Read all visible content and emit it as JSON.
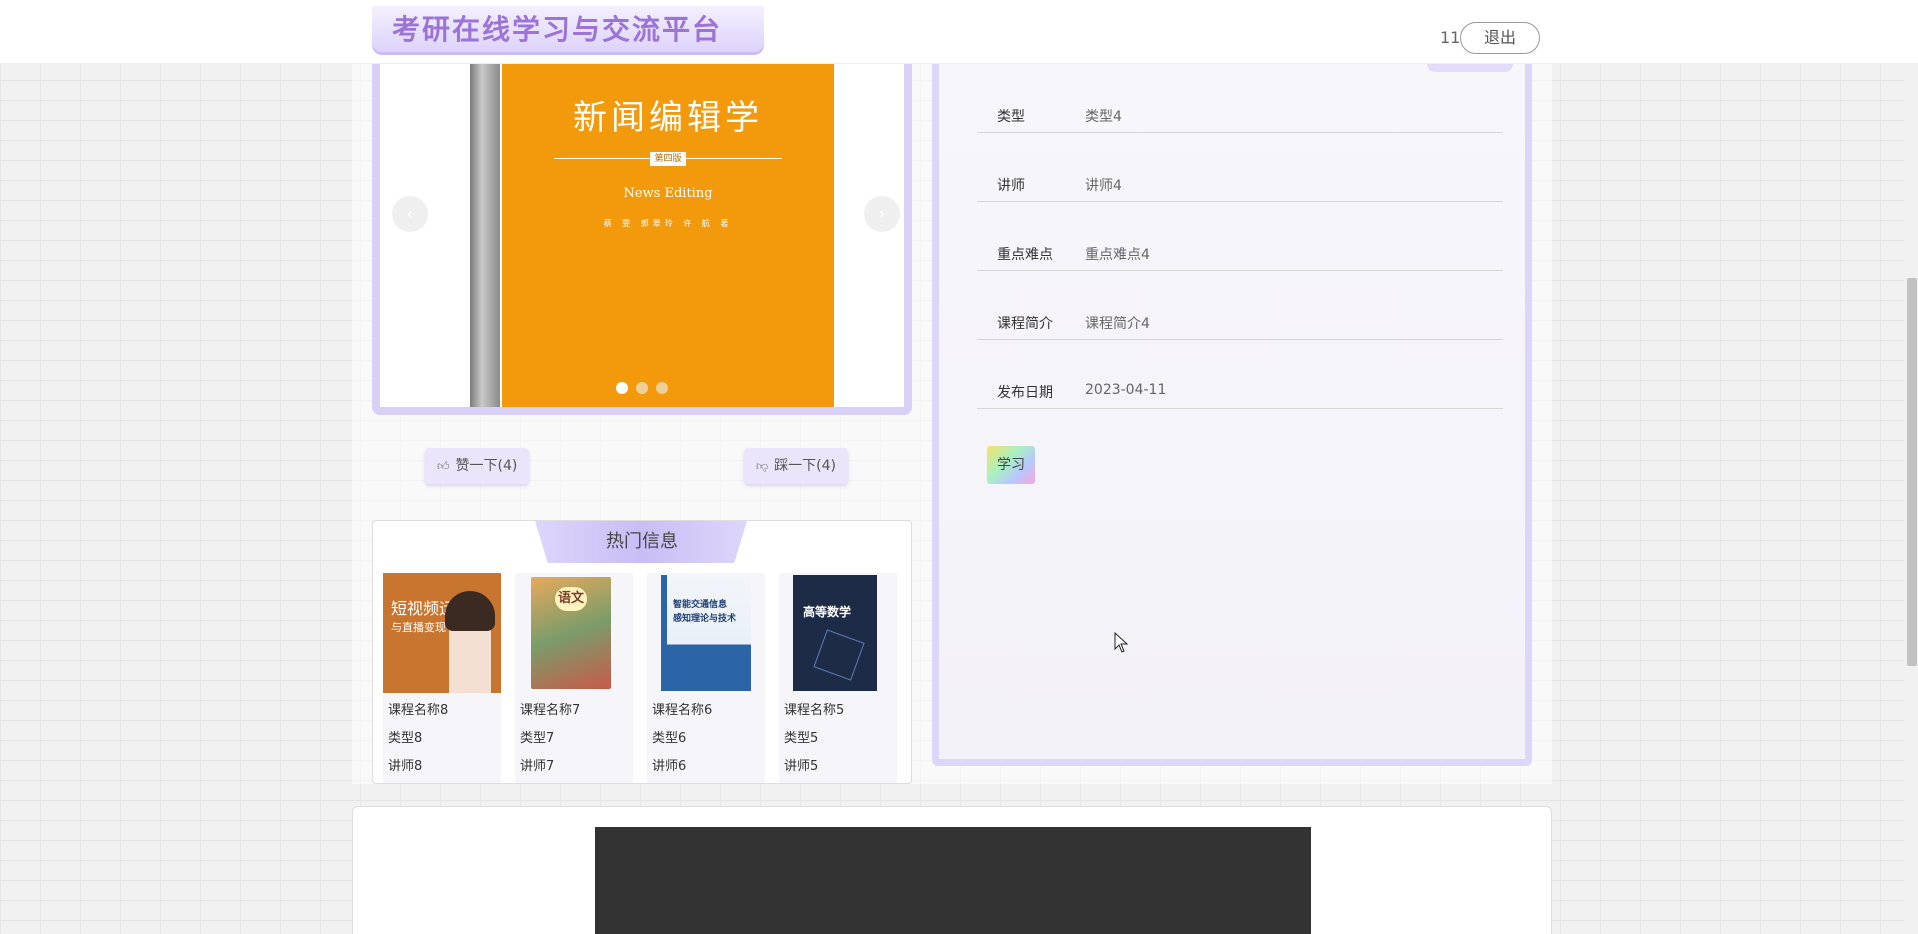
{
  "header": {
    "brand_title": "考研在线学习与交流平台",
    "user_count": "11",
    "logout_label": "退出"
  },
  "carousel": {
    "prev_icon": "chevron-left-icon",
    "next_icon": "chevron-right-icon",
    "active_slide": 1,
    "slide_count": 3,
    "cover": {
      "title": "新闻编辑学",
      "edition": "第四版",
      "subtitle": "News Editing",
      "authors": "蔡 雯 郭翠玲 许 航 著"
    }
  },
  "votes": {
    "like_label": "赞一下(4)",
    "like_icon": "thumbs-up-icon",
    "dislike_label": "踩一下(4)",
    "dislike_icon": "thumbs-down-icon"
  },
  "hot": {
    "title": "热门信息",
    "items": [
      {
        "name": "课程名称8",
        "type": "类型8",
        "teacher": "讲师8",
        "cover_text": "短视频运营",
        "cover_text2": "与直播变现",
        "cover_color": "#c8752f"
      },
      {
        "name": "课程名称7",
        "type": "类型7",
        "teacher": "讲师7",
        "cover_text": "语文",
        "cover_text2": "",
        "cover_color": "#c98a5a"
      },
      {
        "name": "课程名称6",
        "type": "类型6",
        "teacher": "讲师6",
        "cover_text": "智能交通信息",
        "cover_text2": "感知理论与技术",
        "cover_color": "#2c64a8"
      },
      {
        "name": "课程名称5",
        "type": "类型5",
        "teacher": "讲师5",
        "cover_text": "高等数学",
        "cover_text2": "",
        "cover_color": "#1d2b46"
      }
    ]
  },
  "detail": {
    "rows": [
      {
        "label": "类型",
        "value": "类型4"
      },
      {
        "label": "讲师",
        "value": "讲师4"
      },
      {
        "label": "重点难点",
        "value": "重点难点4"
      },
      {
        "label": "课程简介",
        "value": "课程简介4"
      },
      {
        "label": "发布日期",
        "value": "2023-04-11"
      }
    ],
    "study_label": "学习"
  }
}
